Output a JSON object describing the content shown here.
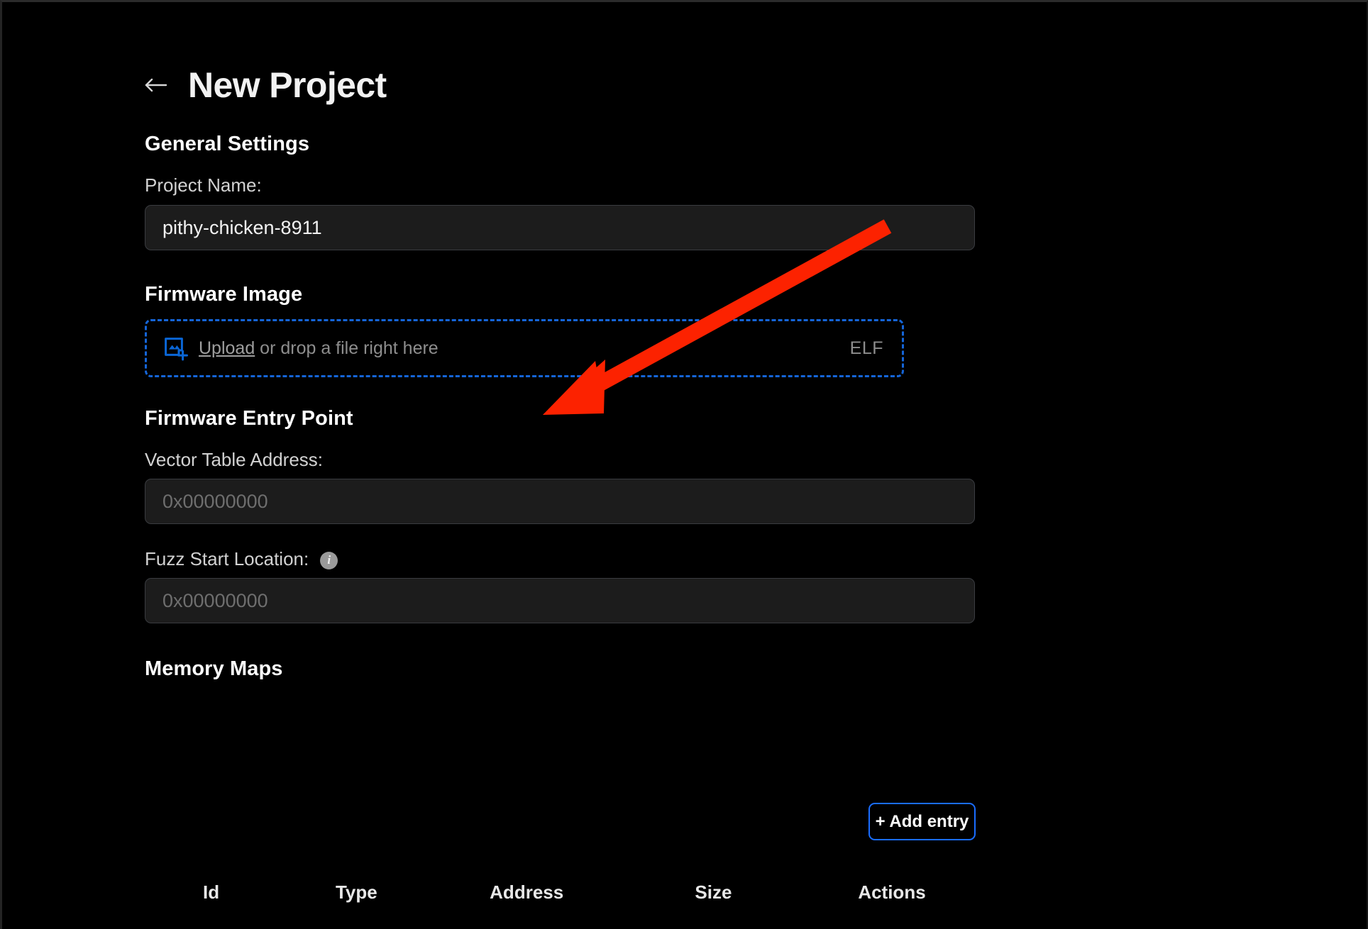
{
  "header": {
    "back_icon": "arrow-left-icon",
    "title": "New Project"
  },
  "general_settings": {
    "heading": "General Settings",
    "project_name": {
      "label": "Project Name:",
      "value": "pithy-chicken-8911",
      "placeholder": ""
    }
  },
  "firmware_image": {
    "heading": "Firmware Image",
    "dropzone": {
      "icon": "add-image-icon",
      "link_text": "Upload",
      "rest_text": " or drop a file right here",
      "format_badge": "ELF"
    }
  },
  "firmware_entry_point": {
    "heading": "Firmware Entry Point",
    "vector_table": {
      "label": "Vector Table Address:",
      "value": "",
      "placeholder": "0x00000000"
    },
    "fuzz_start": {
      "label": "Fuzz Start Location:",
      "info_icon": "info-icon",
      "value": "",
      "placeholder": "0x00000000"
    }
  },
  "memory_maps": {
    "heading": "Memory Maps",
    "add_entry_label": "+ Add entry",
    "columns": [
      "Id",
      "Type",
      "Address",
      "Size",
      "Actions"
    ],
    "rows": []
  },
  "annotation": {
    "type": "arrow",
    "color": "#fc2200",
    "points_to": "firmware-image-dropzone"
  },
  "colors": {
    "background": "#000000",
    "input_background": "#1c1c1c",
    "input_border": "#3a3c40",
    "accent_blue": "#1565d8",
    "button_border": "#1a6dff",
    "muted_text": "#8d8d8d",
    "annotation_red": "#fc2200"
  }
}
